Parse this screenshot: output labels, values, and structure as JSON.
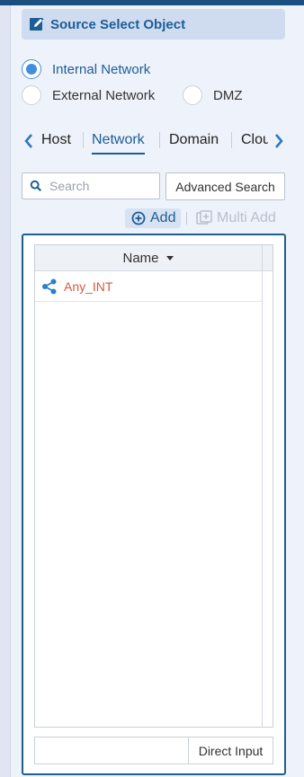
{
  "header": {
    "title": "Source Select Object",
    "icon": "edit-icon"
  },
  "zones": [
    {
      "label": "Internal Network",
      "checked": true
    },
    {
      "label": "External Network",
      "checked": false
    },
    {
      "label": "DMZ",
      "checked": false
    }
  ],
  "tabs": [
    {
      "label": "Host",
      "active": false
    },
    {
      "label": "Network",
      "active": true
    },
    {
      "label": "Domain",
      "active": false
    },
    {
      "label": "Clou",
      "active": false
    }
  ],
  "search": {
    "placeholder": "Search",
    "value": ""
  },
  "toolbar": {
    "advanced_label": "Advanced Search",
    "add_label": "Add",
    "multi_add_label": "Multi Add"
  },
  "grid": {
    "column": "Name",
    "rows": [
      {
        "name": "Any_INT",
        "icon": "share-network-icon"
      }
    ]
  },
  "direct": {
    "button_label": "Direct Input",
    "value": ""
  },
  "colors": {
    "accent": "#1d5d96",
    "highlight": "#d55b3e",
    "radio": "#3f8ee0"
  }
}
